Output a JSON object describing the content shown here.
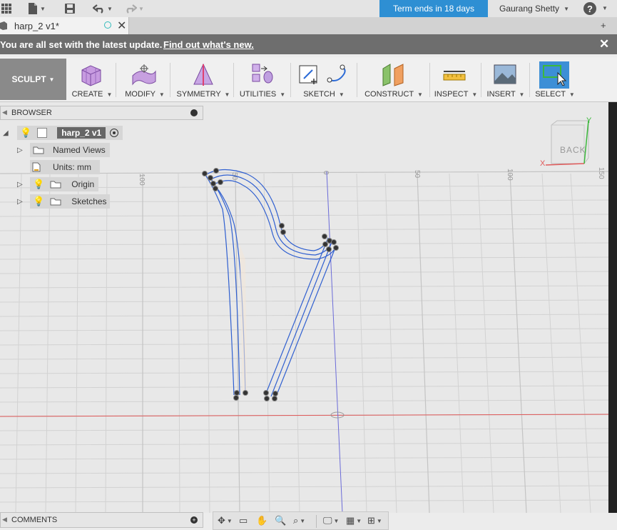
{
  "topbar": {
    "term_text": "Term ends in 18 days",
    "user_name": "Gaurang Shetty",
    "help_symbol": "?"
  },
  "tabs": {
    "doc_title": "harp_2 v1*"
  },
  "banner": {
    "message": "You are all set with the latest update.",
    "link": "Find out what's new."
  },
  "toolbar": {
    "workspace": "SCULPT",
    "groups": [
      "CREATE",
      "MODIFY",
      "SYMMETRY",
      "UTILITIES",
      "SKETCH",
      "CONSTRUCT",
      "INSPECT",
      "INSERT",
      "SELECT"
    ]
  },
  "browser": {
    "header": "BROWSER",
    "root": "harp_2 v1",
    "items": [
      "Named Views",
      "Units: mm",
      "Origin",
      "Sketches"
    ]
  },
  "viewcube": {
    "face": "BACK",
    "axis_x": "X",
    "axis_y": "Y"
  },
  "grid": {
    "ruler_labels": [
      "100",
      "50",
      "0",
      "50",
      "100",
      "150"
    ]
  },
  "comments": {
    "label": "COMMENTS"
  },
  "colors": {
    "accent": "#2e8fd3",
    "banner": "#6e6e6e",
    "sketch_line": "#2f5fd0",
    "axis_red": "#e05a5a",
    "axis_green": "#3cb83c"
  }
}
